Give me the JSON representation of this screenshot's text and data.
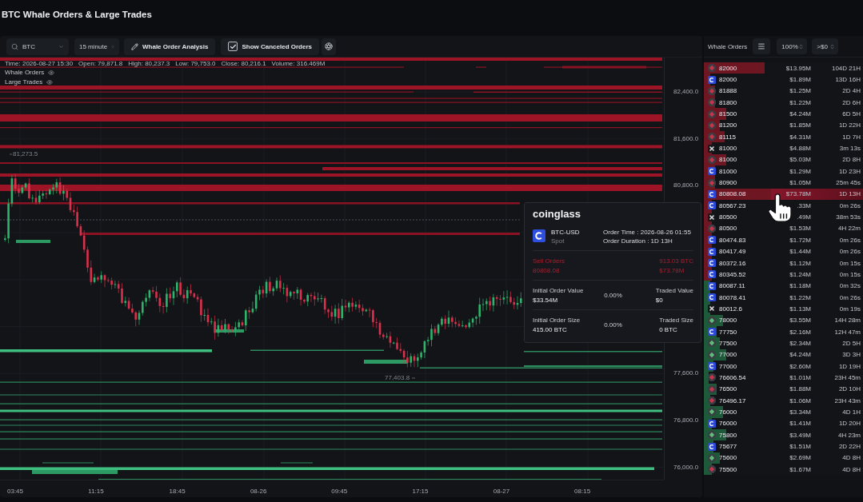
{
  "title": "BTC Whale Orders & Large Trades",
  "toolbar": {
    "search": {
      "value": "BTC"
    },
    "interval": {
      "value": "15 minute"
    },
    "analysis_button": {
      "label": "Whale Order Analysis"
    },
    "canceled_toggle": {
      "label": "Show Canceled Orders",
      "checked": true
    }
  },
  "chart": {
    "info": [
      "Time: 2026-08-27 15:30",
      "Open: 79,871.8",
      "High: 80,237.3",
      "Low: 79,753.0",
      "Close: 80,216.1",
      "Volume: 316.469M"
    ],
    "legend": [
      {
        "label": "Whale Orders",
        "visible": true
      },
      {
        "label": "Large Trades",
        "visible": true
      }
    ],
    "high_marker": "81,273.5",
    "low_marker": "77,403.8",
    "y_axis": {
      "upper": [
        "82,400.0",
        "81,600.0",
        "80,800.0"
      ],
      "lower": [
        "77,600.0",
        "76,800.0",
        "76,000.0"
      ]
    },
    "x_axis": [
      "03:45",
      "11:15",
      "18:45",
      "08-26",
      "09:45",
      "17:15",
      "08-27",
      "08:15"
    ]
  },
  "tooltip": {
    "brand": "coinglass",
    "pair": "BTC-USD",
    "market": "Spot",
    "order_time": "Order Time : 2026-08-26 01:55",
    "order_duration": "Order Duration : 1D 13H",
    "side_label": "Sell Orders",
    "amount": "913.03 BTC",
    "price": "80808.08",
    "value": "$73.78M",
    "stats": [
      {
        "label": "Initial Order Value",
        "value": "$33.54M",
        "percent": "0.00%",
        "traded_label": "Traded Value",
        "traded_value": "$0"
      },
      {
        "label": "Initial Order Size",
        "value": "415.00 BTC",
        "percent": "0.00%",
        "traded_label": "Traded Size",
        "traded_value": "0 BTC"
      }
    ]
  },
  "orders_panel": {
    "title": "Whale Orders",
    "scale": "100%",
    "min_value": ">$0",
    "sell_orders": [
      {
        "kind": "diamond",
        "color": "#c8344a",
        "price": "82000",
        "value": "$13.95M",
        "age": "104D 21H",
        "level": 0.38,
        "selected": false
      },
      {
        "kind": "c-tile",
        "price": "82000",
        "value": "$1.89M",
        "age": "13D 16H",
        "level": 0.04,
        "selected": false
      },
      {
        "kind": "diamond",
        "color": "#c8344a",
        "price": "81888",
        "value": "$1.25M",
        "age": "2D 4H",
        "level": 0.07,
        "selected": false
      },
      {
        "kind": "diamond",
        "color": "#c8344a",
        "price": "81800",
        "value": "$1.22M",
        "age": "2D 6H",
        "level": 0.07,
        "selected": false
      },
      {
        "kind": "diamond",
        "color": "#c8344a",
        "price": "81500",
        "value": "$4.24M",
        "age": "6D 5H",
        "level": 0.14,
        "selected": false
      },
      {
        "kind": "diamond",
        "color": "#c8344a",
        "price": "81200",
        "value": "$1.85M",
        "age": "1D 22H",
        "level": 0.1,
        "selected": false
      },
      {
        "kind": "diamond",
        "color": "#c8344a",
        "price": "81115",
        "value": "$4.31M",
        "age": "1D 7H",
        "level": 0.13,
        "selected": false
      },
      {
        "kind": "cross",
        "price": "81000",
        "value": "$4.88M",
        "age": "3m 13s",
        "level": 0.05,
        "selected": false
      },
      {
        "kind": "diamond",
        "color": "#c8344a",
        "price": "81000",
        "value": "$5.03M",
        "age": "2D 8H",
        "level": 0.14,
        "selected": false
      },
      {
        "kind": "c-tile",
        "price": "81000",
        "value": "$1.29M",
        "age": "1D 23H",
        "level": 0.07,
        "selected": false
      },
      {
        "kind": "diamond",
        "color": "#c8344a",
        "price": "80900",
        "value": "$1.05M",
        "age": "25m 45s",
        "level": 0.07,
        "selected": false
      },
      {
        "kind": "c-tile",
        "price": "80808.08",
        "value": "$73.78M",
        "age": "1D 13H",
        "level": 0.42,
        "selected": true
      },
      {
        "kind": "c-tile",
        "price": "80567.23",
        "value": ".33M",
        "age": "0m 26s",
        "level": 0.05,
        "selected": false
      },
      {
        "kind": "cross",
        "price": "80500",
        "value": ".49M",
        "age": "38m 53s",
        "level": 0.05,
        "selected": false
      },
      {
        "kind": "diamond",
        "color": "#c8344a",
        "price": "80500",
        "value": "$1.53M",
        "age": "4H 22m",
        "level": 0.05,
        "selected": false
      },
      {
        "kind": "c-tile",
        "price": "80474.83",
        "value": "$1.72M",
        "age": "0m 26s",
        "level": 0.05,
        "selected": false
      },
      {
        "kind": "c-tile",
        "price": "80417.49",
        "value": "$1.44M",
        "age": "0m 26s",
        "level": 0.05,
        "selected": false
      },
      {
        "kind": "c-tile",
        "price": "80372.16",
        "value": "$1.12M",
        "age": "0m 15s",
        "level": 0.05,
        "selected": false
      },
      {
        "kind": "c-tile",
        "price": "80345.52",
        "value": "$1.24M",
        "age": "0m 15s",
        "level": 0.05,
        "selected": false
      }
    ],
    "buy_orders": [
      {
        "kind": "c-tile",
        "price": "80087.11",
        "value": "$1.18M",
        "age": "0m 32s",
        "level": 0.04,
        "selected": false
      },
      {
        "kind": "c-tile",
        "price": "80078.41",
        "value": "$1.22M",
        "age": "0m 26s",
        "level": 0.04,
        "selected": false
      },
      {
        "kind": "cross",
        "price": "80012.6",
        "value": "$1.13M",
        "age": "0m 19s",
        "level": 0.04,
        "selected": false
      },
      {
        "kind": "diamond",
        "color": "#5fbf7a",
        "price": "78000",
        "value": "$3.55M",
        "age": "14H 28m",
        "level": 0.12,
        "selected": false
      },
      {
        "kind": "c-tile",
        "price": "77750",
        "value": "$2.16M",
        "age": "12H 47m",
        "level": 0.08,
        "selected": false
      },
      {
        "kind": "diamond",
        "color": "#5fbf7a",
        "price": "77500",
        "value": "$2.34M",
        "age": "2D 5H",
        "level": 0.1,
        "selected": false
      },
      {
        "kind": "diamond",
        "color": "#5fbf7a",
        "price": "77000",
        "value": "$4.24M",
        "age": "3D 3H",
        "level": 0.14,
        "selected": false
      },
      {
        "kind": "c-tile",
        "price": "77000",
        "value": "$2.60M",
        "age": "1D 19H",
        "level": 0.06,
        "selected": false
      },
      {
        "kind": "diamond",
        "color": "#c8344a",
        "price": "76606.54",
        "value": "$1.01M",
        "age": "23H 45m",
        "level": 0.03,
        "selected": false
      },
      {
        "kind": "diamond",
        "color": "#c8344a",
        "price": "76500",
        "value": "$1.88M",
        "age": "2D 10H",
        "level": 0.08,
        "selected": false
      },
      {
        "kind": "diamond",
        "color": "#c8344a",
        "price": "76496.17",
        "value": "$1.06M",
        "age": "23H 43m",
        "level": 0.04,
        "selected": false
      },
      {
        "kind": "diamond",
        "color": "#5fbf7a",
        "price": "76000",
        "value": "$3.34M",
        "age": "4D 1H",
        "level": 0.12,
        "selected": false
      },
      {
        "kind": "c-tile",
        "price": "76000",
        "value": "$1.41M",
        "age": "1D 20H",
        "level": 0.05,
        "selected": false
      },
      {
        "kind": "diamond",
        "color": "#5fbf7a",
        "price": "75800",
        "value": "$3.49M",
        "age": "4H 23m",
        "level": 0.14,
        "selected": false
      },
      {
        "kind": "c-tile",
        "price": "75677",
        "value": "$1.51M",
        "age": "2D 22H",
        "level": 0.06,
        "selected": false
      },
      {
        "kind": "diamond",
        "color": "#5fbf7a",
        "price": "75600",
        "value": "$2.69M",
        "age": "4D 8H",
        "level": 0.1,
        "selected": false
      },
      {
        "kind": "diamond",
        "color": "#c8344a",
        "price": "75500",
        "value": "$1.67M",
        "age": "4D 8H",
        "level": 0.05,
        "selected": false
      }
    ]
  }
}
